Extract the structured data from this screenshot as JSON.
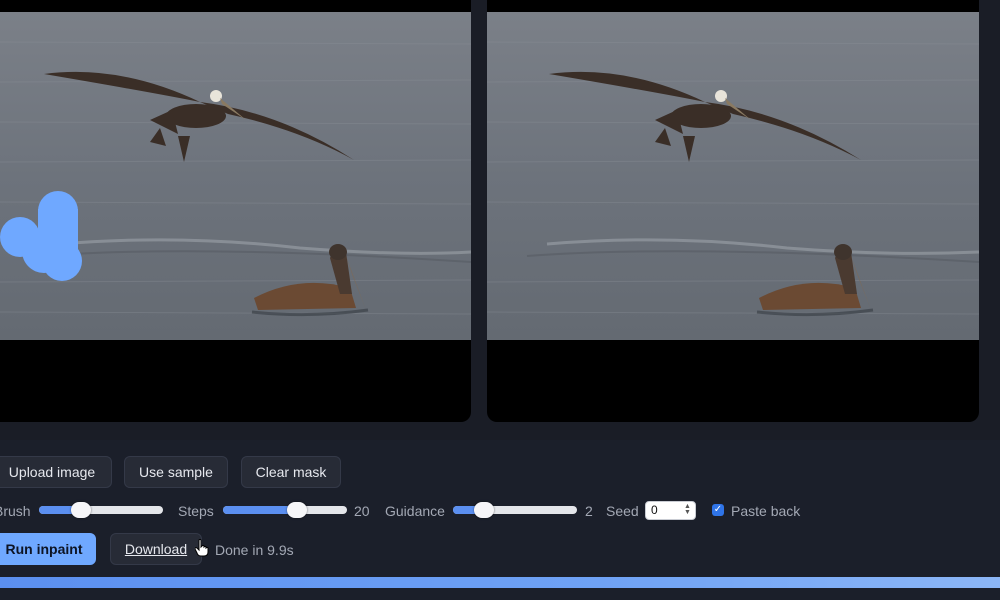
{
  "toolbar": {
    "upload_label": "Upload image",
    "sample_label": "Use sample",
    "clear_label": "Clear mask",
    "run_label": "Run inpaint",
    "download_label": "Download"
  },
  "params": {
    "brush": {
      "label": "Brush",
      "fraction": 0.34
    },
    "steps": {
      "label": "Steps",
      "value": "20",
      "fraction": 0.6
    },
    "guidance": {
      "label": "Guidance",
      "value": "2",
      "fraction": 0.25
    },
    "seed": {
      "label": "Seed",
      "value": "0"
    },
    "paste_back": {
      "label": "Paste back",
      "checked": true
    }
  },
  "status": {
    "text": "Done in 9.9s",
    "progress": 1.0
  },
  "colors": {
    "accent": "#6fa8ff",
    "mask": "#6fa8ff",
    "background": "#1a1d26"
  }
}
